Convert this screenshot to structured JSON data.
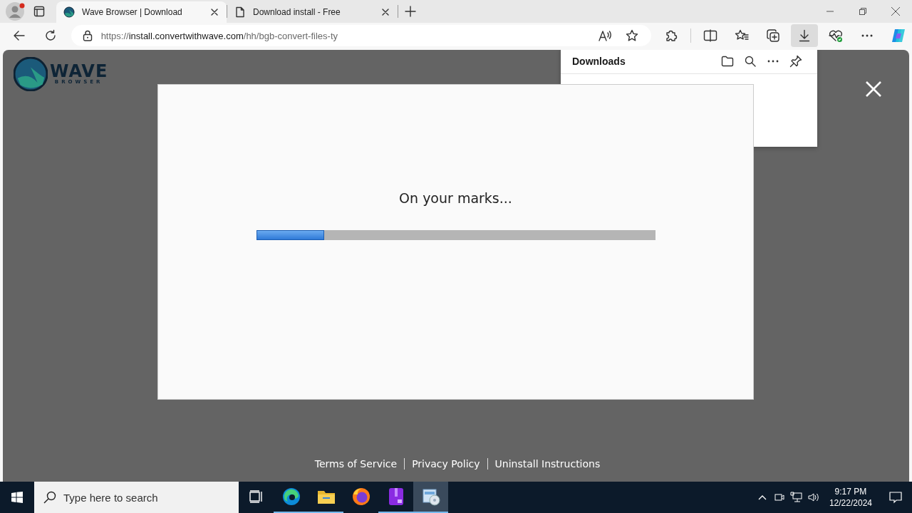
{
  "tabs": [
    {
      "title": "Wave Browser | Download",
      "kind": "logo",
      "selected": true
    },
    {
      "title": "Download install - Free",
      "kind": "document",
      "selected": false
    }
  ],
  "address_bar": {
    "scheme": "https://",
    "host": "install.convertwithwave.com",
    "path": "/hh/bgb-convert-files-ty"
  },
  "toolbar": {
    "downloads_selected": true
  },
  "downloads_panel": {
    "title": "Downloads"
  },
  "page": {
    "logo": {
      "wordmark": "WAVE",
      "tagline": "BROWSER"
    },
    "dialog": {
      "message": "On your marks...",
      "level": 0.17
    },
    "footer_links": [
      "Terms of Service",
      "Privacy Policy",
      "Uninstall Instructions"
    ]
  },
  "taskbar": {
    "search_placeholder": "Type here to search",
    "apps": [
      {
        "kind": "taskview",
        "running": false,
        "selected": false
      },
      {
        "kind": "edge",
        "running": true,
        "selected": false
      },
      {
        "kind": "folder",
        "running": true,
        "selected": false
      },
      {
        "kind": "firefox",
        "running": false,
        "selected": false
      },
      {
        "kind": "archive",
        "running": true,
        "selected": false
      },
      {
        "kind": "installer",
        "running": true,
        "selected": true
      }
    ],
    "clock": {
      "time": "9:17 PM",
      "date": "12/22/2024"
    }
  }
}
